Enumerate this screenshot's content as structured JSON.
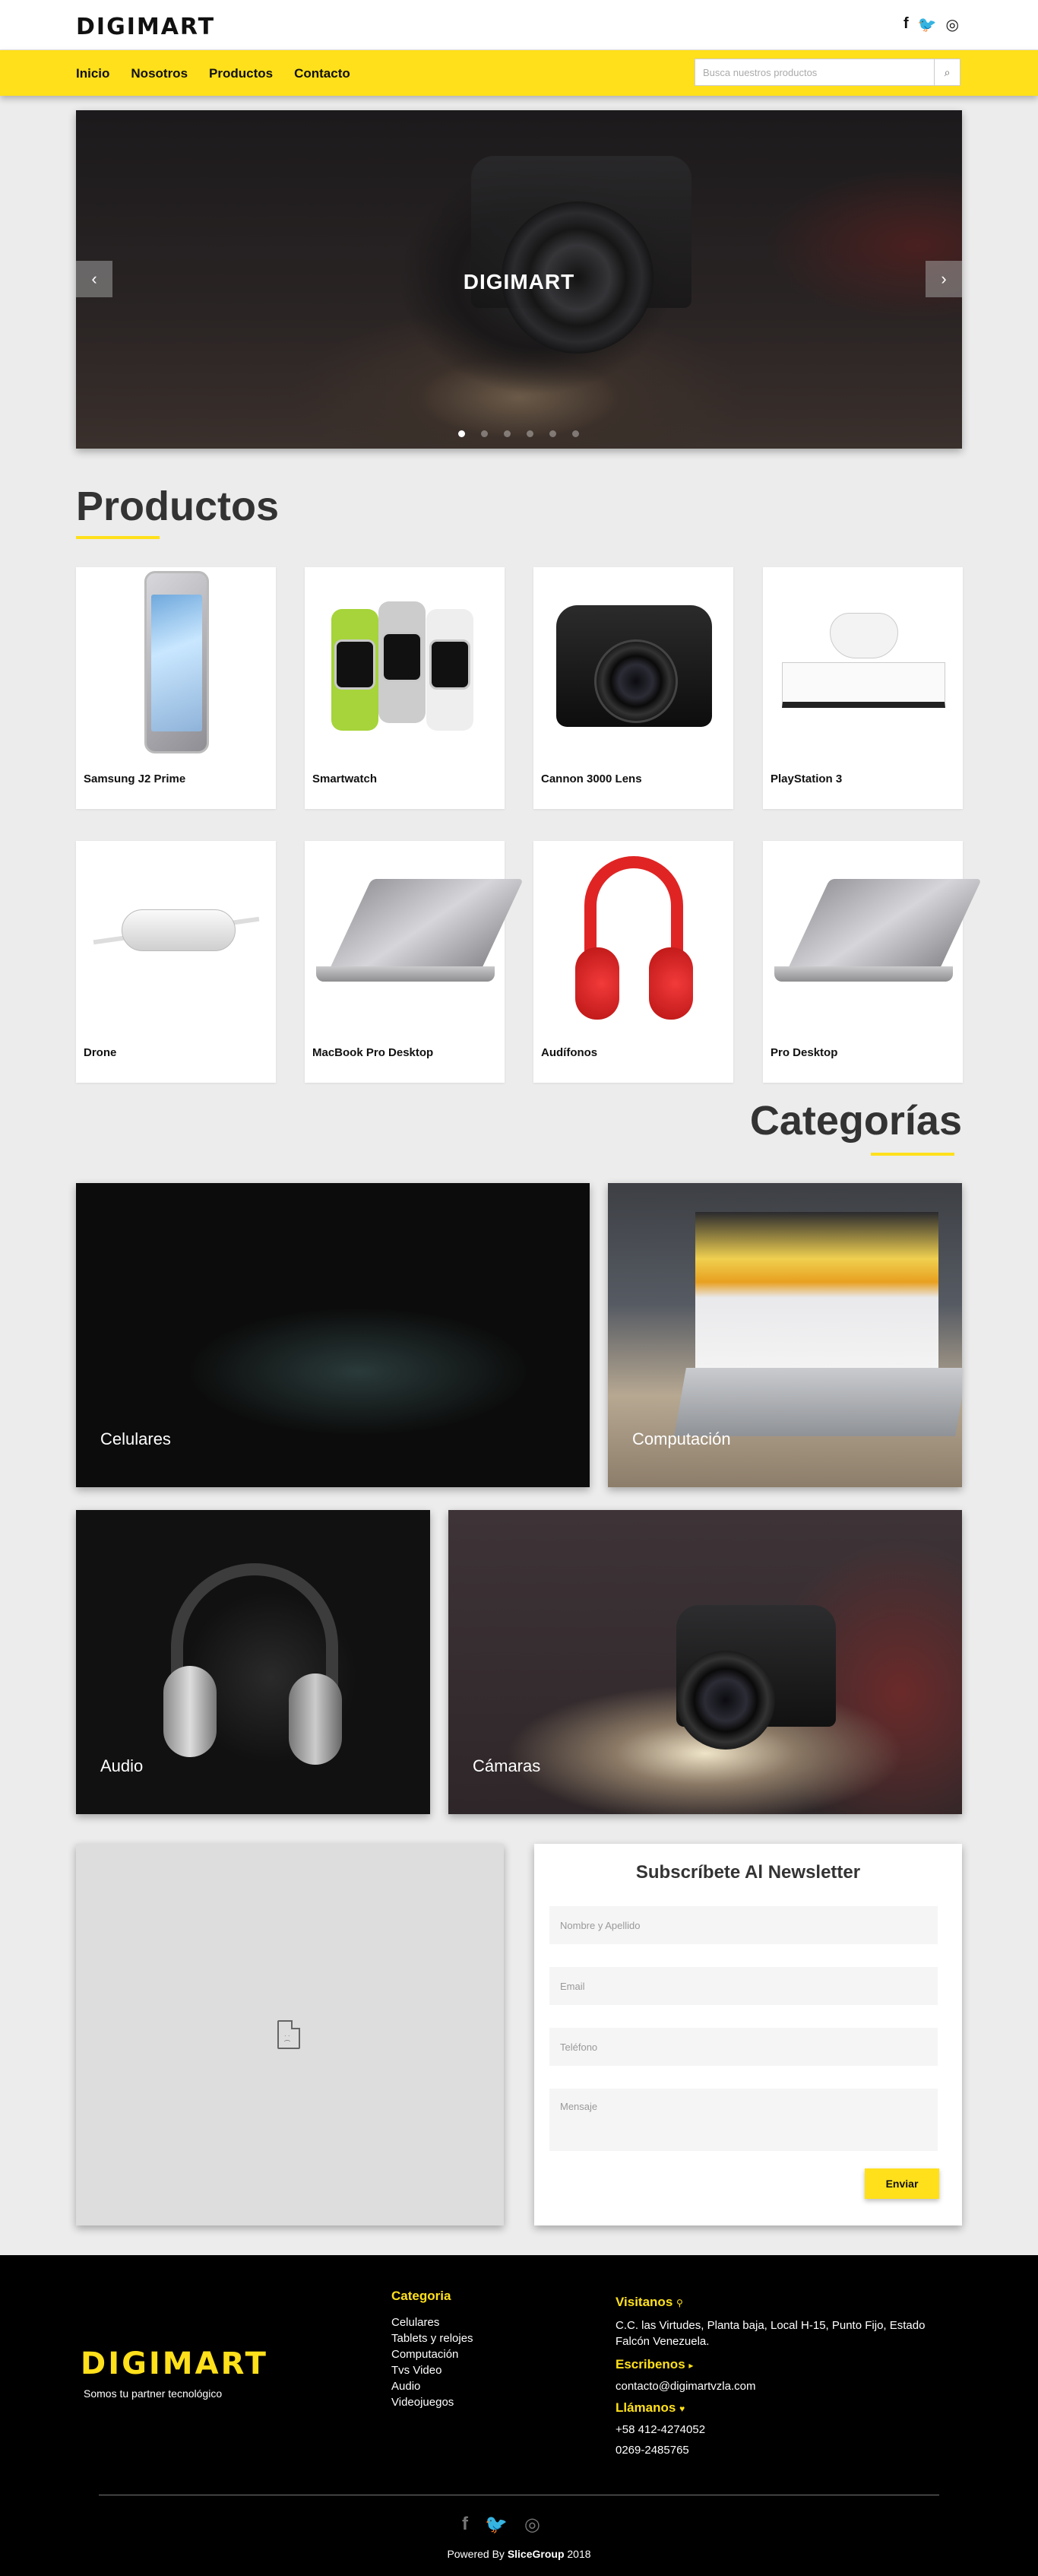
{
  "header": {
    "logo": "DIGIMART",
    "social": [
      {
        "icon": "facebook-icon",
        "glyph": "f"
      },
      {
        "icon": "twitter-icon",
        "glyph": "🐦"
      },
      {
        "icon": "instagram-icon",
        "glyph": "◎"
      }
    ]
  },
  "nav": {
    "links": [
      "Inicio",
      "Nosotros",
      "Productos",
      "Contacto"
    ],
    "search_placeholder": "Busca nuestros productos"
  },
  "hero": {
    "title": "DIGIMART",
    "prev_glyph": "‹",
    "next_glyph": "›",
    "slide_count": 6,
    "active_slide": 0
  },
  "products": {
    "title": "Productos",
    "items": [
      "Samsung J2 Prime",
      "Smartwatch",
      "Cannon 3000 Lens",
      "PlayStation 3",
      "Drone",
      "MacBook Pro Desktop",
      "Audífonos",
      "Pro Desktop"
    ]
  },
  "categories": {
    "title": "Categorías",
    "items": [
      "Celulares",
      "Computación",
      "Audio",
      "Cámaras"
    ]
  },
  "newsletter": {
    "title": "Subscríbete Al Newsletter",
    "name_placeholder": "Nombre y Apellido",
    "email_placeholder": "Email",
    "phone_placeholder": "Teléfono",
    "message_placeholder": "Mensaje",
    "send_label": "Enviar"
  },
  "footer": {
    "logo": "DIGIMART",
    "tagline": "Somos tu partner tecnológico",
    "categories_heading": "Categoria",
    "categories": [
      "Celulares",
      "Tablets y relojes",
      "Computación",
      "Tvs Video",
      "Audio",
      "Videojuegos"
    ],
    "visit_heading": "Visitanos",
    "address": "C.C. las Virtudes, Planta baja, Local H-15, Punto Fijo, Estado Falcón Venezuela.",
    "write_heading": "Escribenos",
    "email": "contacto@digimartvzla.com",
    "call_heading": "Llámanos",
    "phones": [
      "+58 412-4274052",
      "0269-2485765"
    ],
    "powered_prefix": "Powered By",
    "powered_brand": "SliceGroup",
    "powered_year": "2018",
    "accent_color": "#ffe01b"
  }
}
